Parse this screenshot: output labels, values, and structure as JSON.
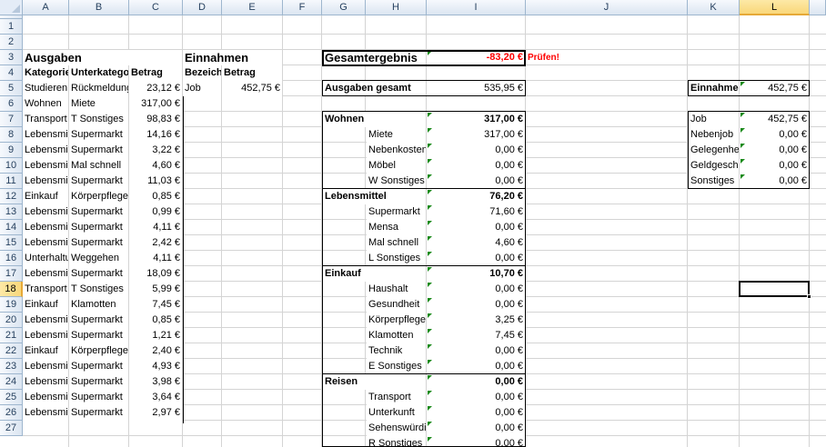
{
  "sheet": {
    "columns": [
      "A",
      "B",
      "C",
      "D",
      "E",
      "F",
      "G",
      "H",
      "I",
      "J",
      "K",
      "L"
    ],
    "rows": [
      "1",
      "2",
      "3",
      "4",
      "5",
      "6",
      "7",
      "8",
      "9",
      "10",
      "11",
      "12",
      "13",
      "14",
      "15",
      "16",
      "17",
      "18",
      "19",
      "20",
      "21",
      "22",
      "23",
      "24",
      "25",
      "26",
      "27"
    ],
    "selected_cell": "L18"
  },
  "ausgaben": {
    "title": "Ausgaben",
    "headers": {
      "kategorie": "Kategorie",
      "unterkategorie": "Unterkategorie",
      "betrag": "Betrag"
    },
    "rows": [
      {
        "kategorie": "Studieren",
        "unterkategorie": "Rückmeldung",
        "betrag": "23,12 €"
      },
      {
        "kategorie": "Wohnen",
        "unterkategorie": "Miete",
        "betrag": "317,00 €"
      },
      {
        "kategorie": "Transport",
        "unterkategorie": "T Sonstiges",
        "betrag": "98,83 €"
      },
      {
        "kategorie": "Lebensmittel",
        "unterkategorie": "Supermarkt",
        "betrag": "14,16 €"
      },
      {
        "kategorie": "Lebensmittel",
        "unterkategorie": "Supermarkt",
        "betrag": "3,22 €"
      },
      {
        "kategorie": "Lebensmittel",
        "unterkategorie": "Mal schnell",
        "betrag": "4,60 €"
      },
      {
        "kategorie": "Lebensmittel",
        "unterkategorie": "Supermarkt",
        "betrag": "11,03 €"
      },
      {
        "kategorie": "Einkauf",
        "unterkategorie": "Körperpflege",
        "betrag": "0,85 €"
      },
      {
        "kategorie": "Lebensmittel",
        "unterkategorie": "Supermarkt",
        "betrag": "0,99 €"
      },
      {
        "kategorie": "Lebensmittel",
        "unterkategorie": "Supermarkt",
        "betrag": "4,11 €"
      },
      {
        "kategorie": "Lebensmittel",
        "unterkategorie": "Supermarkt",
        "betrag": "2,42 €"
      },
      {
        "kategorie": "Unterhaltung",
        "unterkategorie": "Weggehen",
        "betrag": "4,11 €"
      },
      {
        "kategorie": "Lebensmittel",
        "unterkategorie": "Supermarkt",
        "betrag": "18,09 €"
      },
      {
        "kategorie": "Transport",
        "unterkategorie": "T Sonstiges",
        "betrag": "5,99 €"
      },
      {
        "kategorie": "Einkauf",
        "unterkategorie": "Klamotten",
        "betrag": "7,45 €"
      },
      {
        "kategorie": "Lebensmittel",
        "unterkategorie": "Supermarkt",
        "betrag": "0,85 €"
      },
      {
        "kategorie": "Lebensmittel",
        "unterkategorie": "Supermarkt",
        "betrag": "1,21 €"
      },
      {
        "kategorie": "Einkauf",
        "unterkategorie": "Körperpflege",
        "betrag": "2,40 €"
      },
      {
        "kategorie": "Lebensmittel",
        "unterkategorie": "Supermarkt",
        "betrag": "4,93 €"
      },
      {
        "kategorie": "Lebensmittel",
        "unterkategorie": "Supermarkt",
        "betrag": "3,98 €"
      },
      {
        "kategorie": "Lebensmittel",
        "unterkategorie": "Supermarkt",
        "betrag": "3,64 €"
      },
      {
        "kategorie": "Lebensmittel",
        "unterkategorie": "Supermarkt",
        "betrag": "2,97 €"
      }
    ]
  },
  "einnahmen": {
    "title": "Einnahmen",
    "headers": {
      "bezeichnung": "Bezeichnung",
      "betrag": "Betrag"
    },
    "rows": [
      {
        "bezeichnung": "Job",
        "betrag": "452,75 €"
      }
    ]
  },
  "summary": {
    "gesamt_label": "Gesamtergebnis",
    "gesamt_value": "-83,20 €",
    "warning": "Prüfen!",
    "ausgaben_label": "Ausgaben gesamt",
    "ausgaben_value": "535,95 €",
    "categories": [
      {
        "name": "Wohnen",
        "total": "317,00 €",
        "items": [
          {
            "name": "Miete",
            "value": "317,00 €"
          },
          {
            "name": "Nebenkosten",
            "value": "0,00 €"
          },
          {
            "name": "Möbel",
            "value": "0,00 €"
          },
          {
            "name": "W Sonstiges",
            "value": "0,00 €"
          }
        ]
      },
      {
        "name": "Lebensmittel",
        "total": "76,20 €",
        "items": [
          {
            "name": "Supermarkt",
            "value": "71,60 €"
          },
          {
            "name": "Mensa",
            "value": "0,00 €"
          },
          {
            "name": "Mal schnell",
            "value": "4,60 €"
          },
          {
            "name": "L Sonstiges",
            "value": "0,00 €"
          }
        ]
      },
      {
        "name": "Einkauf",
        "total": "10,70 €",
        "items": [
          {
            "name": "Haushalt",
            "value": "0,00 €"
          },
          {
            "name": "Gesundheit",
            "value": "0,00 €"
          },
          {
            "name": "Körperpflege",
            "value": "3,25 €"
          },
          {
            "name": "Klamotten",
            "value": "7,45 €"
          },
          {
            "name": "Technik",
            "value": "0,00 €"
          },
          {
            "name": "E Sonstiges",
            "value": "0,00 €"
          }
        ]
      },
      {
        "name": "Reisen",
        "total": "0,00 €",
        "items": [
          {
            "name": "Transport",
            "value": "0,00 €"
          },
          {
            "name": "Unterkunft",
            "value": "0,00 €"
          },
          {
            "name": "Sehenswürdigkeiten",
            "value": "0,00 €"
          },
          {
            "name": "R Sonstiges",
            "value": "0,00 €"
          }
        ]
      }
    ]
  },
  "einnahmen_summary": {
    "label": "Einnahmen",
    "value": "452,75 €",
    "items": [
      {
        "name": "Job",
        "value": "452,75 €"
      },
      {
        "name": "Nebenjob",
        "value": "0,00 €"
      },
      {
        "name": "Gelegenheitsjob",
        "value": "0,00 €"
      },
      {
        "name": "Geldgeschenk",
        "value": "0,00 €"
      },
      {
        "name": "Sonstiges",
        "value": "0,00 €"
      }
    ]
  },
  "colors": {
    "warning": "#ff0000",
    "selection_header": "#f9d77a",
    "header_bg": "#dbe5f1",
    "comment_marker": "#1b8a1b"
  }
}
